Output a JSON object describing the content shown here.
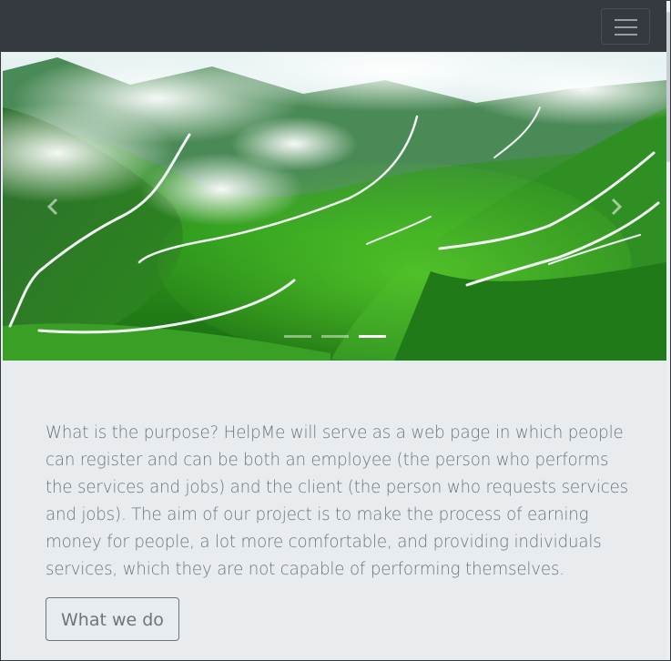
{
  "navbar": {
    "toggler_icon": "hamburger-menu-icon",
    "background_color": "#343a40"
  },
  "carousel": {
    "image_description_icon": "mountain-valley-landscape",
    "prev_icon": "chevron-left-icon",
    "next_icon": "chevron-right-icon",
    "slide_count": 3,
    "active_slide_index": 2
  },
  "main": {
    "purpose_text": "What is the purpose? HelpMe will serve as a web page in which people can register and can be both an employee (the person who performs the services and jobs) and the client (the person who requests services and jobs). The aim of our project is to make the process of earning money for people, a lot more comfortable, and providing individuals services, which they are not capable of performing themselves.",
    "cta_label": "What we do"
  },
  "colors": {
    "page_background": "#e9ecef",
    "text_muted": "#6c757d"
  }
}
